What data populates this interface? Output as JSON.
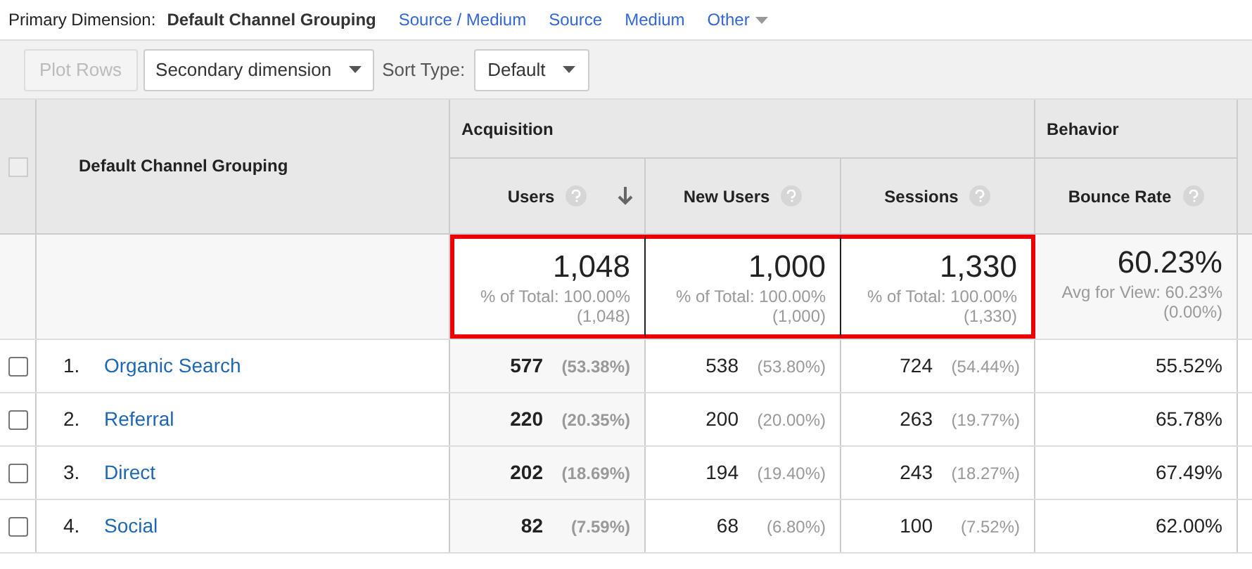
{
  "primary_dimension": {
    "label": "Primary Dimension:",
    "options": [
      {
        "label": "Default Channel Grouping",
        "selected": true
      },
      {
        "label": "Source / Medium",
        "selected": false
      },
      {
        "label": "Source",
        "selected": false
      },
      {
        "label": "Medium",
        "selected": false
      },
      {
        "label": "Other",
        "selected": false,
        "dropdown": true
      }
    ]
  },
  "toolbar": {
    "plot_rows": {
      "label": "Plot Rows",
      "disabled": true
    },
    "secondary_dimension": "Secondary dimension",
    "sort_type_label": "Sort Type:",
    "sort_type": "Default"
  },
  "table": {
    "select_all_checked": false,
    "dimension_header": "Default Channel Grouping",
    "groups": [
      {
        "label": "Acquisition",
        "columns": [
          {
            "label": "Users",
            "sorted": true
          },
          {
            "label": "New Users",
            "sorted": false
          },
          {
            "label": "Sessions",
            "sorted": false
          }
        ]
      },
      {
        "label": "Behavior",
        "columns": [
          {
            "label": "Bounce Rate",
            "sorted": false
          }
        ]
      }
    ],
    "totals": [
      {
        "value": "1,048",
        "note": "% of Total: 100.00%",
        "note2": "(1,048)",
        "highlighted": true
      },
      {
        "value": "1,000",
        "note": "% of Total: 100.00%",
        "note2": "(1,000)",
        "highlighted": true
      },
      {
        "value": "1,330",
        "note": "% of Total: 100.00%",
        "note2": "(1,330)",
        "highlighted": true
      },
      {
        "value": "60.23%",
        "note": "Avg for View: 60.23%",
        "note2": "(0.00%)",
        "highlighted": false
      }
    ],
    "rows": [
      {
        "index": "1.",
        "name": "Organic Search",
        "checked": false,
        "cells": [
          {
            "value": "577",
            "pct": "(53.38%)"
          },
          {
            "value": "538",
            "pct": "(53.80%)"
          },
          {
            "value": "724",
            "pct": "(54.44%)"
          },
          {
            "value": "55.52%"
          }
        ]
      },
      {
        "index": "2.",
        "name": "Referral",
        "checked": false,
        "cells": [
          {
            "value": "220",
            "pct": "(20.35%)"
          },
          {
            "value": "200",
            "pct": "(20.00%)"
          },
          {
            "value": "263",
            "pct": "(19.77%)"
          },
          {
            "value": "65.78%"
          }
        ]
      },
      {
        "index": "3.",
        "name": "Direct",
        "checked": false,
        "cells": [
          {
            "value": "202",
            "pct": "(18.69%)"
          },
          {
            "value": "194",
            "pct": "(19.40%)"
          },
          {
            "value": "243",
            "pct": "(18.27%)"
          },
          {
            "value": "67.49%"
          }
        ]
      },
      {
        "index": "4.",
        "name": "Social",
        "checked": false,
        "cells": [
          {
            "value": "82",
            "pct": "(7.59%)"
          },
          {
            "value": "68",
            "pct": "(6.80%)"
          },
          {
            "value": "100",
            "pct": "(7.52%)"
          },
          {
            "value": "62.00%"
          }
        ]
      }
    ]
  }
}
